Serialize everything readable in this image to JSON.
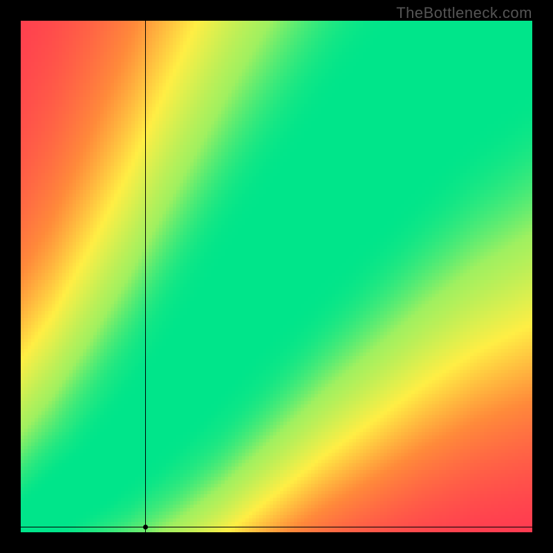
{
  "watermark": "TheBottleneck.com",
  "chart_data": {
    "type": "heatmap",
    "title": "",
    "xlabel": "",
    "ylabel": "",
    "xlim": [
      0,
      100
    ],
    "ylim": [
      0,
      100
    ],
    "colorscale": [
      {
        "stop": 0.0,
        "color": "#ff2a55"
      },
      {
        "stop": 0.35,
        "color": "#ff8a3a"
      },
      {
        "stop": 0.6,
        "color": "#ffee44"
      },
      {
        "stop": 0.85,
        "color": "#9ff060"
      },
      {
        "stop": 1.0,
        "color": "#00e58a"
      }
    ],
    "ridge": {
      "description": "Optimal-balance curve; value=1 along this path, decaying with distance",
      "points": [
        {
          "x": 0,
          "y": 0
        },
        {
          "x": 8,
          "y": 6
        },
        {
          "x": 15,
          "y": 11
        },
        {
          "x": 22,
          "y": 18
        },
        {
          "x": 30,
          "y": 27
        },
        {
          "x": 40,
          "y": 40
        },
        {
          "x": 50,
          "y": 53
        },
        {
          "x": 60,
          "y": 65
        },
        {
          "x": 70,
          "y": 77
        },
        {
          "x": 80,
          "y": 88
        },
        {
          "x": 90,
          "y": 97
        },
        {
          "x": 100,
          "y": 105
        }
      ],
      "ridge_width_base": 3,
      "ridge_width_top": 14,
      "falloff_sigma_base": 16,
      "falloff_sigma_top": 60
    },
    "crosshair": {
      "x": 24,
      "y": 1
    },
    "grid": false,
    "legend": false
  }
}
